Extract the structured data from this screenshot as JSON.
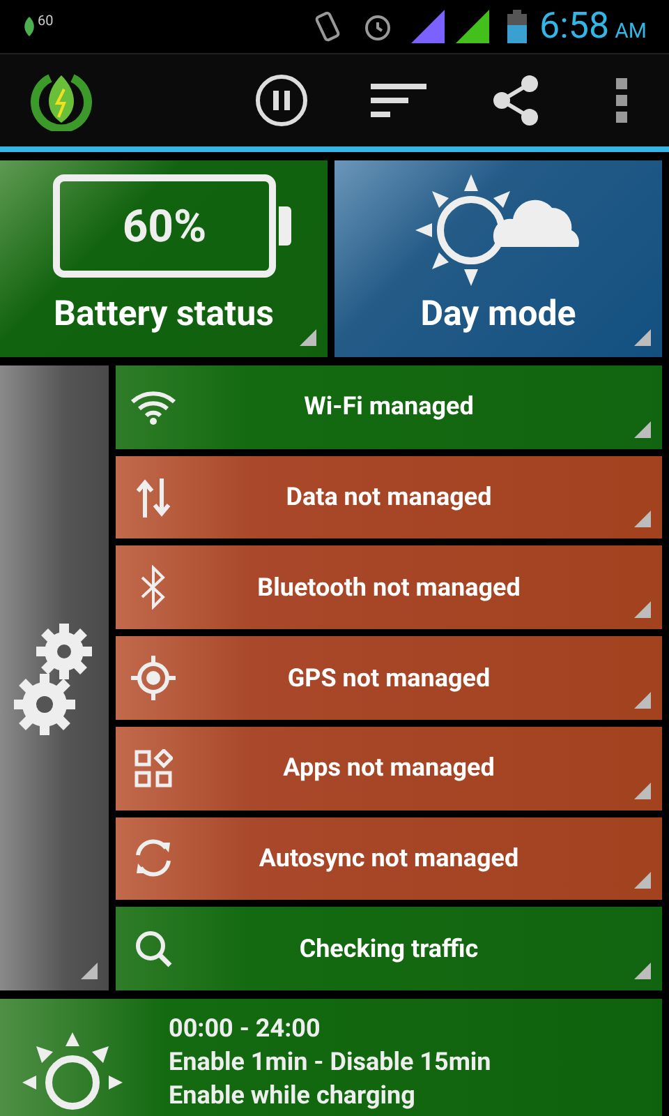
{
  "status_bar": {
    "battery_percent": "60",
    "time": "6:58",
    "am_pm": "AM"
  },
  "tiles": [
    {
      "kind": "battery",
      "label": "Battery status",
      "value": "60%"
    },
    {
      "kind": "day",
      "label": "Day mode"
    }
  ],
  "toggles": [
    {
      "kind": "wifi",
      "label": "Wi-Fi managed",
      "managed": true
    },
    {
      "kind": "data",
      "label": "Data not managed",
      "managed": false
    },
    {
      "kind": "bluetooth",
      "label": "Bluetooth not managed",
      "managed": false
    },
    {
      "kind": "gps",
      "label": "GPS not managed",
      "managed": false
    },
    {
      "kind": "apps",
      "label": "Apps not managed",
      "managed": false
    },
    {
      "kind": "sync",
      "label": "Autosync not managed",
      "managed": false
    },
    {
      "kind": "search",
      "label": "Checking traffic",
      "managed": true
    }
  ],
  "schedule": {
    "lines": [
      "00:00 - 24:00",
      "Enable 1min - Disable 15min",
      "Enable while charging"
    ]
  }
}
